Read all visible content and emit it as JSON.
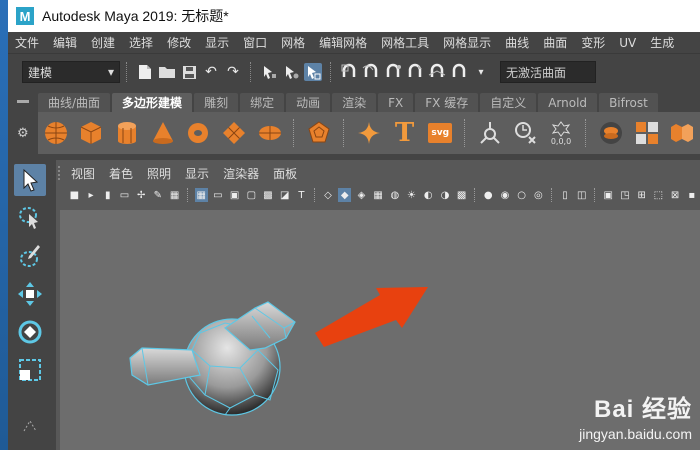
{
  "window": {
    "title": "Autodesk Maya 2019: 无标题*",
    "logo_letter": "M"
  },
  "menubar": [
    "文件",
    "编辑",
    "创建",
    "选择",
    "修改",
    "显示",
    "窗口",
    "网格",
    "编辑网格",
    "网格工具",
    "网格显示",
    "曲线",
    "曲面",
    "变形",
    "UV",
    "生成"
  ],
  "statusline": {
    "mode_dropdown": "建模",
    "live_surface_field": "无激活曲面",
    "icons": [
      "new-scene-icon",
      "open-scene-icon",
      "save-scene-icon",
      "undo-icon",
      "redo-icon",
      "select-hierarchy-icon",
      "select-object-icon",
      "select-component-icon",
      "snap-grid-icon",
      "snap-curve-icon",
      "snap-point-icon",
      "snap-projected-icon",
      "snap-view-plane-icon",
      "make-live-icon"
    ]
  },
  "shelf": {
    "tabs": [
      "曲线/曲面",
      "多边形建模",
      "雕刻",
      "绑定",
      "动画",
      "渲染",
      "FX",
      "FX 缓存",
      "自定义",
      "Arnold",
      "Bifrost"
    ],
    "active_tab": "多边形建模",
    "icons": [
      "poly-sphere-icon",
      "poly-cube-icon",
      "poly-cylinder-icon",
      "poly-cone-icon",
      "poly-torus-icon",
      "poly-plane-icon",
      "poly-disc-icon",
      "platonic-solid-icon",
      "super-shape-icon",
      "type-icon",
      "svg-icon",
      "sweep-mesh-icon",
      "mesh-cleanup-icon",
      "uv-numbers-icon",
      "smooth-icon",
      "combine-icon",
      "separate-icon"
    ],
    "svg_label": "svg",
    "type_label": "T"
  },
  "viewport_menu": [
    "视图",
    "着色",
    "照明",
    "显示",
    "渲染器",
    "面板"
  ],
  "watermark": {
    "brand": "Bai 经验",
    "url": "jingyan.baidu.com"
  },
  "colors": {
    "accent": "#5d82a6",
    "arrow": "#e8410f",
    "selection": "#5ec8e6"
  }
}
